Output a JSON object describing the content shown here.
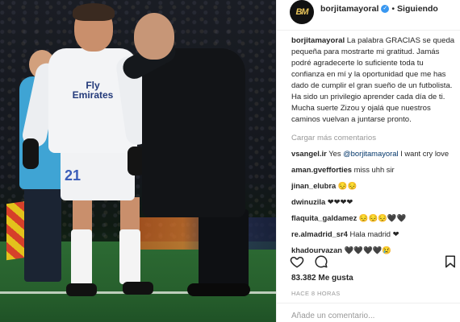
{
  "post": {
    "image_alt": "Zidane speaking to Borja Mayoral on the touchline"
  },
  "photo": {
    "sponsor_line1": "Fly",
    "sponsor_line2": "Emirates",
    "shorts_number": "21"
  },
  "header": {
    "avatar_text": "BM",
    "username": "borjitamayoral",
    "verified_icon": "verified-badge-icon",
    "separator": "•",
    "follow_status": "Siguiendo"
  },
  "caption": {
    "username": "borjitamayoral",
    "text": "La palabra GRACIAS se queda pequeña para mostrarte mi gratitud. Jamás podré agradecerte lo suficiente toda tu confianza en mí y la oportunidad que me has dado de cumplir el gran sueño de un futbolista. Ha sido un privilegio aprender cada día de ti. Mucha suerte Zizou y ojalá que nuestros caminos vuelvan a juntarse pronto."
  },
  "load_more": "Cargar más comentarios",
  "comments": [
    {
      "username": "vsangel.ir",
      "pre": "Yes ",
      "mention": "@borjitamayoral",
      "post": " I want cry love"
    },
    {
      "username": "aman.gvefforties",
      "pre": "miss uhh sir",
      "mention": "",
      "post": ""
    },
    {
      "username": "jinan_elubra",
      "pre": "😔😔",
      "mention": "",
      "post": ""
    },
    {
      "username": "dwinuzila",
      "pre": "❤❤❤❤",
      "mention": "",
      "post": ""
    },
    {
      "username": "flaquita_galdamez",
      "pre": "😔😔😔🖤🖤",
      "mention": "",
      "post": ""
    },
    {
      "username": "re.almadrid_sr4",
      "pre": "Hala madrid ❤",
      "mention": "",
      "post": ""
    },
    {
      "username": "khadourvazan",
      "pre": "🖤🖤🖤🖤😢",
      "mention": "",
      "post": ""
    }
  ],
  "actions": {
    "like_icon": "heart-icon",
    "comment_icon": "comment-bubble-icon",
    "save_icon": "bookmark-icon"
  },
  "likes": "83.382 Me gusta",
  "time": "HACE 8 HORAS",
  "add_comment_placeholder": "Añade un comentario...",
  "colors": {
    "link": "#003569",
    "muted": "#999999",
    "verified": "#3897f0",
    "text": "#262626"
  }
}
